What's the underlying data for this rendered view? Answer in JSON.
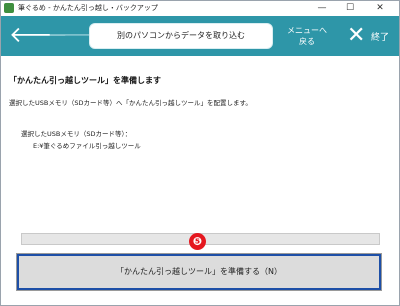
{
  "window": {
    "title": "筆ぐるめ - かんたん引っ越し・バックアップ",
    "minimize": "—",
    "maximize": "☐",
    "close": "✕"
  },
  "toolbar": {
    "back_icon": "arrow-left",
    "forward_icon": "arrow-right",
    "page_title": "別のパソコンからデータを取り込む",
    "menu_line1": "メニューへ",
    "menu_line2": "戻る",
    "exit_label": "終了",
    "exit_icon": "close-x",
    "color": "#2e96a8"
  },
  "main": {
    "heading": "「かんたん引っ越しツール」を準備します",
    "description": "選択したUSBメモリ（SDカード等）へ「かんたん引っ越しツール」を配置します。",
    "field_label": "選択したUSBメモリ（SDカード等）：",
    "field_value": "E:¥筆ぐるめファイル引っ越しツール"
  },
  "progress": {
    "value": 0
  },
  "badge": {
    "label": "❺",
    "color": "#e5171f"
  },
  "prepare_button": {
    "label": "「かんたん引っ越しツール」を準備する（N）"
  }
}
